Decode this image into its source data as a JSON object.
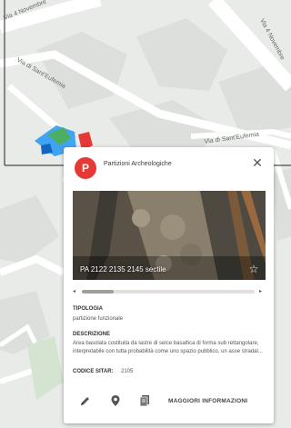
{
  "map": {
    "streets": [
      "Via 4 Novembre",
      "Via 4 Novembre",
      "Via di Sant'Eufemia",
      "Via di Sant'Eufemia"
    ]
  },
  "panel": {
    "avatar_letter": "P",
    "title": "Partizioni Archeologiche",
    "close_icon": "close-icon",
    "photo": {
      "caption": "PA 2122 2135 2145 sectile",
      "star_icon": "star-outline-icon"
    },
    "scroll_left": "◂",
    "scroll_right": "▸",
    "tipologia_label": "TIPOLOGIA",
    "tipologia_value": "partizione funzionale",
    "descrizione_label": "DESCRIZIONE",
    "descrizione_value": "Area basolata costituita da lastre di selce basaltica di forma sub rettangolare, interpretabile con tutta probabilità come uno spazio pubblico, un asse stradal...",
    "codice_label": "CODICE SITAR:",
    "codice_value": "2105",
    "more_button": "MAGGIORI INFORMAZIONI"
  },
  "colors": {
    "accent": "#e53935",
    "map_bg": "#e7eae6",
    "road": "#ffffff",
    "building": "#d9dcd8"
  }
}
